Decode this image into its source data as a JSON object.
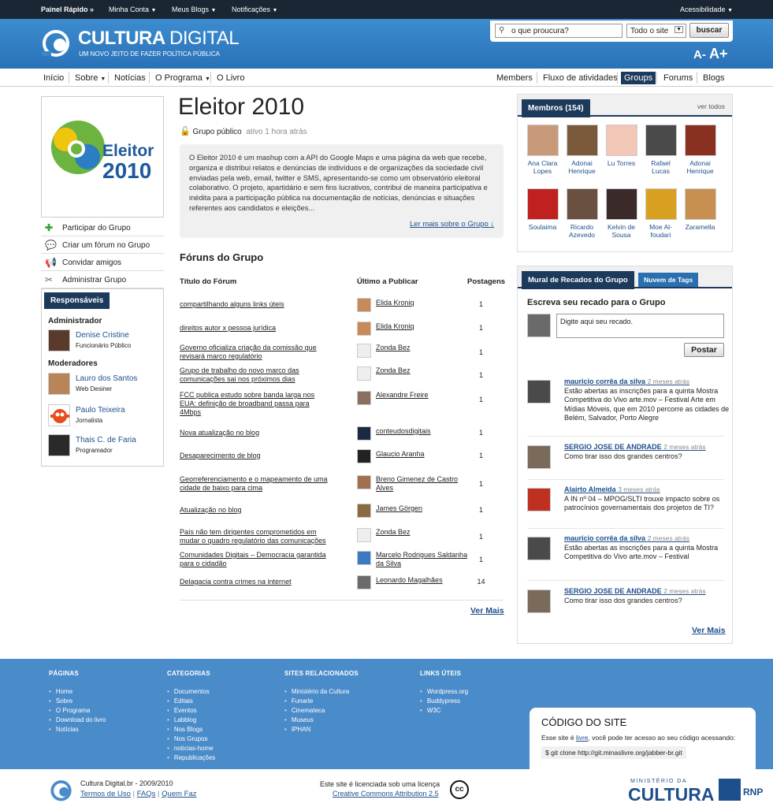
{
  "topbar": {
    "quick": "Painel Rápido »",
    "account": "Minha Conta",
    "blogs": "Meus Blogs",
    "notifications": "Notificações",
    "accessibility": "Acessibilidade"
  },
  "header": {
    "brand_bold": "CULTURA",
    "brand_light": "DIGITAL",
    "tagline": "UM NOVO JEITO DE FAZER POLÍTICA PÚBLICA",
    "font_small": "A-",
    "font_big": "A+"
  },
  "search": {
    "placeholder": "o que proucura?",
    "scope": "Todo o site",
    "button": "buscar"
  },
  "nav": {
    "left": [
      "Início",
      "Sobre",
      "Notícias",
      "O Programa",
      "O Livro"
    ],
    "right": [
      "Members",
      "Fluxo de atividades",
      "Groups",
      "Forums",
      "Blogs"
    ]
  },
  "group": {
    "title": "Eleitor 2010",
    "logo_line1": "Eleitor",
    "logo_line2": "2010",
    "type": "Grupo público",
    "activity": "ativo 1 hora atrás",
    "description": "O Eleitor 2010 é um mashup com a API do Google Maps e uma página da web que recebe, organiza e distribui relatos e denúncias de indivíduos e de organizações da sociedade civil enviadas pela web, email, twitter e SMS, apresentando-se como um observatório eleitoral colaborativo. O projeto, apartidário e sem fins lucrativos, contribui de maneira participativa e inédita para a participação pública na documentação de notícias, denúncias e situações referentes aos candidatos e eleições...",
    "read_more": "Ler mais sobre o Grupo ↓"
  },
  "actions": [
    "Participar do Grupo",
    "Criar um fórum no Grupo",
    "Convidar amigos",
    "Administrar Grupo"
  ],
  "responsible": {
    "tab": "Responsáveis",
    "admin_label": "Administrador",
    "mods_label": "Moderadores",
    "admins": [
      {
        "name": "Denise Cristine",
        "role": "Funcionário Público"
      }
    ],
    "mods": [
      {
        "name": "Lauro dos Santos",
        "role": "Web Desiner"
      },
      {
        "name": "Paulo Teixeira",
        "role": "Jornalista"
      },
      {
        "name": "Thais C. de Faria",
        "role": "Programador"
      }
    ]
  },
  "forums": {
    "heading": "Fóruns do Grupo",
    "col_title": "Título do Fórum",
    "col_last": "Último a Publicar",
    "col_posts": "Postagens",
    "more": "Ver Mais",
    "rows": [
      {
        "t": "compartilhando alguns links úteis",
        "p": "Elida Kroniq",
        "n": "1"
      },
      {
        "t": "direitos autor x pessoa jurídica",
        "p": "Elida Kroniq",
        "n": "1"
      },
      {
        "t": "Governo oficializa criação da comissão que revisará marco regulatório",
        "p": "Zonda Bez",
        "n": "1"
      },
      {
        "t": "Grupo de trabalho do novo marco das comunicações sai nos próximos dias",
        "p": "Zonda Bez",
        "n": "1"
      },
      {
        "t": "FCC publica estudo sobre banda larga nos EUA: definição de broadband passa para 4Mbps",
        "p": "Alexandre Freire",
        "n": "1"
      },
      {
        "t": "Nova atualização no blog",
        "p": "conteudosdigitais",
        "n": "1"
      },
      {
        "t": "Desaparecimento de blog",
        "p": "Glaucio Aranha",
        "n": "1"
      },
      {
        "t": "Georreferenciamento e o mapeamento de uma cidade de baixo para cima",
        "p": "Breno Gimenez de Castro Alves",
        "n": "1"
      },
      {
        "t": "Atualização no blog",
        "p": "James Görgen",
        "n": "1"
      },
      {
        "t": "País não tem dirigentes comprometidos em mudar o quadro regulatório das comunicações",
        "p": "Zonda Bez",
        "n": "1"
      },
      {
        "t": "Comunidades Digitais – Democracia garantida para o cidadão",
        "p": "Marcelo Rodrigues Saldanha da Silva",
        "n": "1"
      },
      {
        "t": "Delagacia contra crimes na internet",
        "p": "Leonardo Magalhães",
        "n": "14"
      }
    ]
  },
  "members": {
    "tab": "Membros (154)",
    "see_all": "ver todos",
    "list": [
      {
        "name": "Ana Clara Lopes",
        "color": "#c99a7a"
      },
      {
        "name": "Adonai Henrique",
        "color": "#7a5a3a"
      },
      {
        "name": "Lu Torres",
        "color": "#f2c7b8"
      },
      {
        "name": "Rafael Lucas",
        "color": "#4a4a4a"
      },
      {
        "name": "Adonai Henrique",
        "color": "#8a3020"
      },
      {
        "name": "Soulaima",
        "color": "#c02020"
      },
      {
        "name": "Ricardo Azevedo",
        "color": "#6a5040"
      },
      {
        "name": "Kelvin de Sousa",
        "color": "#3a2a2a"
      },
      {
        "name": "Moe Al-foudari",
        "color": "#d8a020"
      },
      {
        "name": "Zaramella",
        "color": "#c89050"
      }
    ]
  },
  "wall": {
    "tab1": "Mural de Recados do Grupo",
    "tab2": "Nuvem de Tags",
    "prompt": "Escreva seu recado para o Grupo",
    "input_placeholder": "Digite aqui seu recado.",
    "post_button": "Postar",
    "more": "Ver Mais",
    "posts": [
      {
        "author": "mauricio corrêa da silva",
        "time": "2 meses atrás",
        "text": "Estão abertas as inscrições para a quinta Mostra Competitiva do Vivo arte.mov – Festival Arte em Mídias Móveis, que em 2010 percorre as cidades de Belém, Salvador, Porto Alegre"
      },
      {
        "author": "SERGIO JOSE DE ANDRADE",
        "time": "2 meses atrás",
        "text": "Como tirar isso dos grandes centros?"
      },
      {
        "author": "Alairto Almeida",
        "time": "3 meses atrás",
        "text": "A IN nº 04 – MPOG/SLTI trouxe impacto sobre os patrocínios governamentais dos projetos de TI?"
      },
      {
        "author": "mauricio corrêa da silva",
        "time": "2 meses atrás",
        "text": "Estão abertas as inscrições para a quinta Mostra Competitiva do Vivo arte.mov – Festival"
      },
      {
        "author": "SERGIO JOSE DE ANDRADE",
        "time": "2 meses atrás",
        "text": "Como tirar isso dos grandes centros?"
      }
    ]
  },
  "footer": {
    "cols": [
      {
        "h": "PÁGINAS",
        "items": [
          "Home",
          "Sobre",
          "O Programa",
          "Download do livro",
          "Notícias"
        ]
      },
      {
        "h": "CATEGORIAS",
        "items": [
          "Documentos",
          "Editais",
          "Eventos",
          "Labblog",
          "Nos Blogs",
          "Nos Grupos",
          "noticias-home",
          "Republicações"
        ]
      },
      {
        "h": "SITES RELACIONADOS",
        "items": [
          "Ministério da Cultura",
          "Funarte",
          "Cinemateca",
          "Museus",
          "IPHAN"
        ]
      },
      {
        "h": "LINKS ÚTEIS",
        "items": [
          "Wordpress.org",
          "Buddypress",
          "W3C"
        ]
      }
    ],
    "code": {
      "title": "CÓDIGO DO SITE",
      "text_pre": "Esse site é ",
      "text_link": "livre",
      "text_post": ", você pode ter acesso ao seu código acessando:",
      "cmd": "$ git clone http://git.minaslivre.org/jabber-br.git"
    },
    "copy": "Cultura Digital.br -  2009/2010",
    "terms": "Termos de Uso",
    "faqs": "FAQs",
    "who": "Quem Faz",
    "license_line1": "Este site é licenciada sob uma licença",
    "license_link": "Creative Commons Attribution 2.5",
    "ministry_small": "MINISTÉRIO DA",
    "ministry_big": "CULTURA",
    "rnp": "RNP",
    "cc": "cc"
  }
}
